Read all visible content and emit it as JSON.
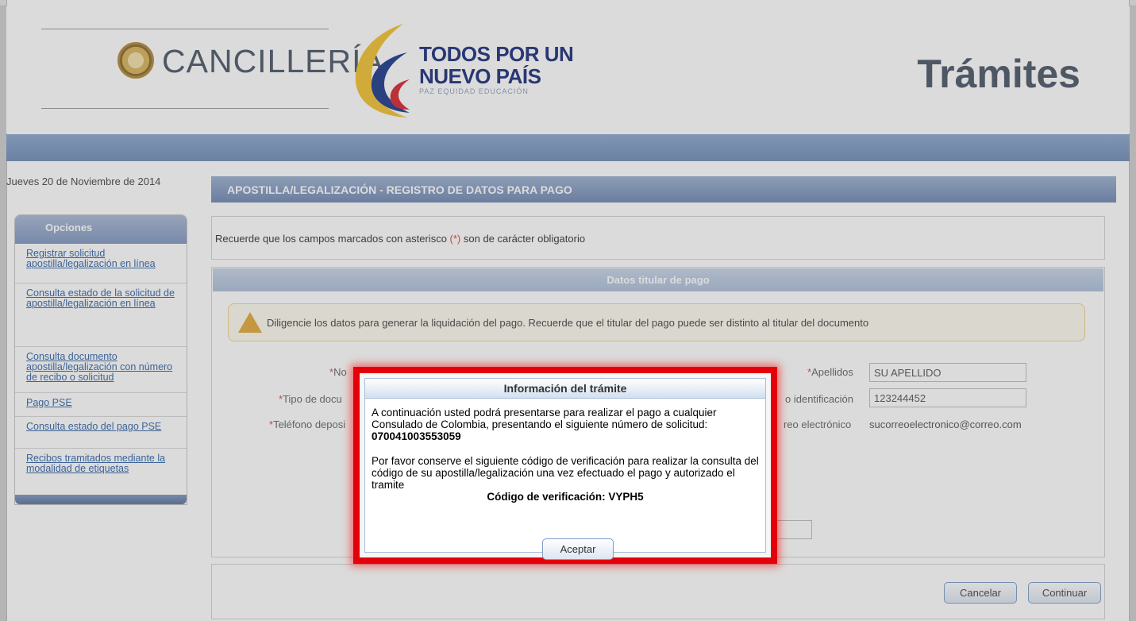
{
  "header": {
    "cancilleria": "CANCILLERÍA",
    "campaign_line1": "TODOS POR UN",
    "campaign_line2": "NUEVO PAÍS",
    "campaign_tagline": "PAZ  EQUIDAD  EDUCACIÓN",
    "tramites": "Trámites"
  },
  "sidebar": {
    "date": "Jueves 20 de Noviembre de 2014",
    "options_title": "Opciones",
    "items": [
      {
        "label": "Registrar solicitud apostilla/legalización en línea"
      },
      {
        "label": "Consulta estado de la solicitud de apostilla/legalización en línea"
      },
      {
        "label": "Consulta documento apostilla/legalización con número de recibo o solicitud"
      },
      {
        "label": "Pago PSE"
      },
      {
        "label": "Consulta estado del pago PSE"
      },
      {
        "label": "Recibos tramitados mediante la modalidad de etiquetas"
      }
    ]
  },
  "main": {
    "title": "APOSTILLA/LEGALIZACIÓN - REGISTRO DE DATOS PARA PAGO",
    "notice_before": "Recuerde que los campos marcados con asterisco ",
    "notice_ast": "(*)",
    "notice_after": " son de carácter obligatorio",
    "panel_title": "Datos titular de pago",
    "warning": "Diligencie los datos para generar la liquidación del pago. Recuerde que el titular del pago puede ser distinto al titular del documento",
    "fields": {
      "nombres_label": "No",
      "apellidos_label": "Apellidos",
      "apellidos_value": "SU APELLIDO",
      "tipo_doc_label": "Tipo de docu",
      "num_id_label": "o identificación",
      "num_id_value": "123244452",
      "telefono_label": "Teléfono deposi",
      "correo_label": "reo electrónico",
      "correo_value": "sucorreoelectronico@correo.com"
    },
    "cancel_label": "Cancelar",
    "continue_label": "Continuar"
  },
  "modal": {
    "title": "Información del trámite",
    "para1": "A continuación usted podrá presentarse para realizar el pago a cualquier Consulado de Colombia, presentando el siguiente número de solicitud: ",
    "request_number": "070041003553059",
    "para2": "Por favor conserve el siguiente código de verificación para realizar la consulta del código de su apostilla/legalización una vez efectuado el pago y autorizado el tramite",
    "verification": "Código de verificación: VYPH5",
    "accept_label": "Aceptar"
  }
}
